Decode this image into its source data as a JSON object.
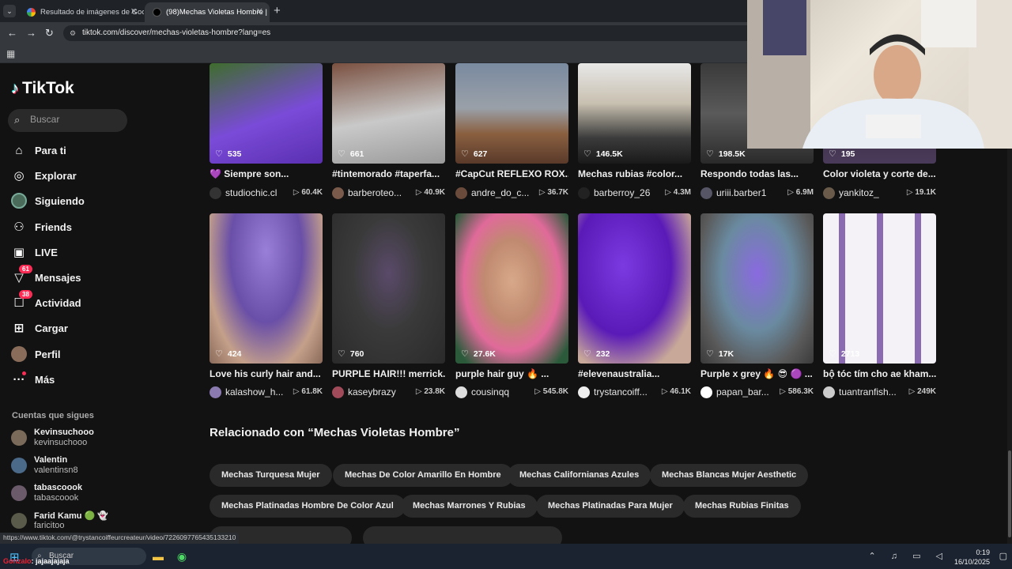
{
  "browser": {
    "tabs": [
      {
        "title": "Resultado de imágenes de Goo",
        "active": false
      },
      {
        "title": "(98)Mechas Violetas Hombre |",
        "active": true
      }
    ],
    "url": "tiktok.com/discover/mechas-violetas-hombre?lang=es",
    "status_url": "https://www.tiktok.com/@trystancoiffeurcreateur/video/7226097765435133210"
  },
  "sidebar": {
    "brand": "TikTok",
    "search_placeholder": "Buscar",
    "nav": [
      {
        "label": "Para ti",
        "icon": "home-icon"
      },
      {
        "label": "Explorar",
        "icon": "compass-icon"
      },
      {
        "label": "Siguiendo",
        "icon": "following-avatar-icon"
      },
      {
        "label": "Friends",
        "icon": "friends-icon"
      },
      {
        "label": "LIVE",
        "icon": "live-icon"
      },
      {
        "label": "Mensajes",
        "icon": "messages-icon",
        "badge": "61"
      },
      {
        "label": "Actividad",
        "icon": "activity-icon",
        "badge": "38"
      },
      {
        "label": "Cargar",
        "icon": "upload-icon"
      },
      {
        "label": "Perfil",
        "icon": "profile-avatar-icon"
      },
      {
        "label": "Más",
        "icon": "more-icon"
      }
    ],
    "following_header": "Cuentas que sigues",
    "following": [
      {
        "name": "Kevinsuchooo",
        "handle": "kevinsuchooo"
      },
      {
        "name": "Valentin",
        "handle": "valentinsn8"
      },
      {
        "name": "tabascoook",
        "handle": "tabascoook"
      },
      {
        "name": "Farid Kamu 🟢 👻",
        "handle": "faricitoo"
      }
    ]
  },
  "grid": {
    "row1": [
      {
        "likes": "535",
        "caption": "💜 Siempre son...",
        "user": "studiochic.cl",
        "views": "60.4K"
      },
      {
        "likes": "661",
        "caption": "#tintemorado #taperfa...",
        "user": "barberoteo...",
        "views": "40.9K"
      },
      {
        "likes": "627",
        "caption": "#CapCut REFLEXO ROX...",
        "user": "andre_do_c...",
        "views": "36.7K"
      },
      {
        "likes": "146.5K",
        "caption": "Mechas rubias #color...",
        "user": "barberroy_26",
        "views": "4.3M"
      },
      {
        "likes": "198.5K",
        "caption": "Respondo todas las...",
        "user": "uriii.barber1",
        "views": "6.9M"
      },
      {
        "likes": "195",
        "caption": "Color violeta y corte de...",
        "user": "yankitoz_",
        "views": "19.1K"
      }
    ],
    "row2": [
      {
        "likes": "424",
        "caption": "Love his curly hair and...",
        "user": "kalashow_h...",
        "views": "61.8K"
      },
      {
        "likes": "760",
        "caption": "PURPLE HAIR!!! merrick...",
        "user": "kaseybrazy",
        "views": "23.8K"
      },
      {
        "likes": "27.6K",
        "caption": "purple hair guy 🔥 ...",
        "user": "cousinqq",
        "views": "545.8K"
      },
      {
        "likes": "232",
        "caption": "#elevenaustralia...",
        "user": "trystancoiff...",
        "views": "46.1K"
      },
      {
        "likes": "17K",
        "caption": "Purple x grey 🔥 😎 🟣 ...",
        "user": "papan_bar...",
        "views": "586.3K"
      },
      {
        "likes": "2713",
        "caption": "bộ tóc tím cho ae kham...",
        "user": "tuantranfish...",
        "views": "249K"
      }
    ]
  },
  "related": {
    "title": "Relacionado con “Mechas Violetas Hombre”",
    "row1": [
      "Mechas Turquesa Mujer",
      "Mechas De Color Amarillo En Hombre",
      "Mechas Californianas Azules",
      "Mechas Blancas Mujer Aesthetic"
    ],
    "row2": [
      "Mechas Platinadas Hombre De Color Azul",
      "Mechas Marrones Y Rubias",
      "Mechas Platinadas Para Mujer",
      "Mechas Rubias Finitas"
    ]
  },
  "taskbar": {
    "search_placeholder": "Buscar",
    "chat_user": "Gonzalo",
    "chat_text": ": jajaajajaja",
    "time": "0:19",
    "date": "16/10/2025"
  }
}
